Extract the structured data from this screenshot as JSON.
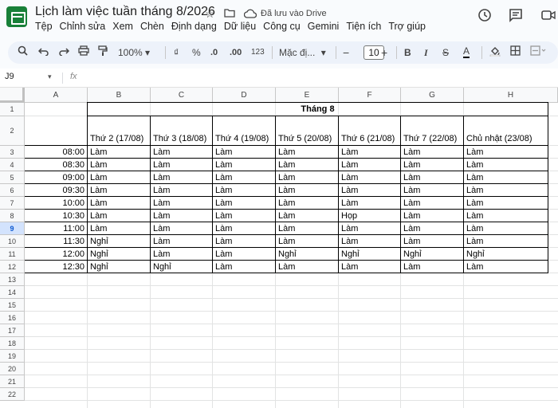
{
  "app": {
    "title": "Lịch làm việc tuần tháng 8/2026",
    "saved_status": "Đã lưu vào Drive"
  },
  "menu": [
    "Tệp",
    "Chỉnh sửa",
    "Xem",
    "Chèn",
    "Định dạng",
    "Dữ liệu",
    "Công cụ",
    "Gemini",
    "Tiện ích",
    "Trợ giúp"
  ],
  "toolbar": {
    "zoom": "100%",
    "currency": "₫",
    "percent": "%",
    "dec_decrease": ".0",
    "dec_increase": ".00",
    "number_format": "123",
    "font": "Mặc đị...",
    "font_size": "10",
    "minus": "−",
    "plus": "+",
    "bold": "B",
    "italic": "I",
    "strike": "S",
    "text_color": "A"
  },
  "formula_bar": {
    "cell_ref": "J9",
    "fx": "fx",
    "value": ""
  },
  "columns": [
    "A",
    "B",
    "C",
    "D",
    "E",
    "F",
    "G",
    "H"
  ],
  "rows": [
    "1",
    "2",
    "3",
    "4",
    "5",
    "6",
    "7",
    "8",
    "9",
    "10",
    "11",
    "12",
    "13",
    "14",
    "15",
    "16",
    "17",
    "18",
    "19",
    "20",
    "21",
    "22"
  ],
  "selected_row": "9",
  "sheet": {
    "month_header": "Tháng 8",
    "day_headers": [
      "Thứ 2 (17/08)",
      "Thứ 3 (18/08)",
      "Thứ 4 (19/08)",
      "Thứ 5 (20/08)",
      "Thứ 6 (21/08)",
      "Thứ 7 (22/08)",
      "Chủ nhật (23/08)"
    ],
    "times": [
      "08:00",
      "08:30",
      "09:00",
      "09:30",
      "10:00",
      "10:30",
      "11:00",
      "11:30",
      "12:00",
      "12:30"
    ],
    "schedule": [
      [
        "Làm",
        "Làm",
        "Làm",
        "Làm",
        "Làm",
        "Làm",
        "Làm"
      ],
      [
        "Làm",
        "Làm",
        "Làm",
        "Làm",
        "Làm",
        "Làm",
        "Làm"
      ],
      [
        "Làm",
        "Làm",
        "Làm",
        "Làm",
        "Làm",
        "Làm",
        "Làm"
      ],
      [
        "Làm",
        "Làm",
        "Làm",
        "Làm",
        "Làm",
        "Làm",
        "Làm"
      ],
      [
        "Làm",
        "Làm",
        "Làm",
        "Làm",
        "Làm",
        "Làm",
        "Làm"
      ],
      [
        "Làm",
        "Làm",
        "Làm",
        "Làm",
        "Họp",
        "Làm",
        "Làm"
      ],
      [
        "Làm",
        "Làm",
        "Làm",
        "Làm",
        "Làm",
        "Làm",
        "Làm"
      ],
      [
        "Nghỉ",
        "Làm",
        "Làm",
        "Làm",
        "Làm",
        "Làm",
        "Làm"
      ],
      [
        "Nghỉ",
        "Làm",
        "Làm",
        "Nghỉ",
        "Nghỉ",
        "Nghỉ",
        "Nghỉ"
      ],
      [
        "Nghỉ",
        "Nghỉ",
        "Làm",
        "Làm",
        "Làm",
        "Làm",
        "Làm"
      ]
    ]
  }
}
